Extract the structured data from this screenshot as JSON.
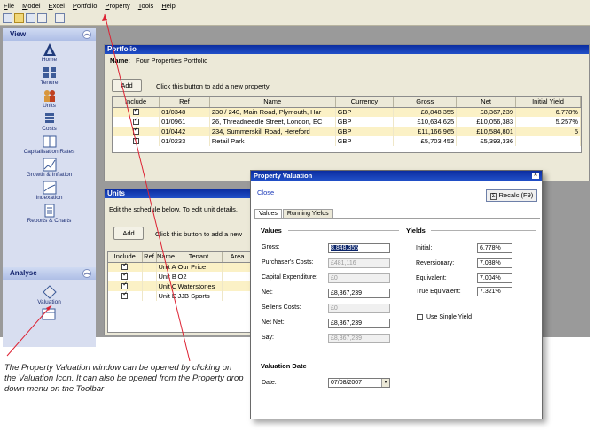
{
  "menu": [
    "File",
    "Model",
    "Excel",
    "Portfolio",
    "Property",
    "Tools",
    "Help"
  ],
  "view_panel": {
    "title": "View",
    "items": [
      "Home",
      "Tenure",
      "Units",
      "Costs",
      "Capitalisation Rates",
      "Growth & Inflation",
      "Indexation",
      "Reports & Charts"
    ]
  },
  "analyse_panel": {
    "title": "Analyse",
    "items": [
      "Valuation"
    ]
  },
  "portfolio": {
    "window_title": "Portfolio",
    "name_label": "Name:",
    "name_value": "Four Properties Portfolio",
    "add_label": "Add",
    "add_hint": "Click this button to add a new property",
    "columns": [
      "Include",
      "Ref",
      "Name",
      "Currency",
      "Gross",
      "Net",
      "Initial Yield"
    ],
    "rows": [
      {
        "ref": "01/0348",
        "name": "230 / 240, Main Road, Plymouth, Har",
        "currency": "GBP",
        "gross": "£8,848,355",
        "net": "£8,367,239",
        "yield": "6.778%"
      },
      {
        "ref": "01/0961",
        "name": "26, Threadneedle Street, London, EC",
        "currency": "GBP",
        "gross": "£10,634,625",
        "net": "£10,056,383",
        "yield": "5.257%"
      },
      {
        "ref": "01/0442",
        "name": "234, Summerskill Road, Hereford",
        "currency": "GBP",
        "gross": "£11,166,965",
        "net": "£10,584,801",
        "yield": "5"
      },
      {
        "ref": "01/0233",
        "name": "Retail Park",
        "currency": "GBP",
        "gross": "£5,703,453",
        "net": "£5,393,336",
        "yield": ""
      }
    ]
  },
  "units": {
    "window_title": "Units",
    "hint": "Edit the schedule below. To edit unit details,",
    "add_label": "Add",
    "add_hint": "Click this button to add a new",
    "columns": [
      "Include",
      "Ref",
      "Name",
      "Tenant",
      "Area"
    ],
    "rows": [
      {
        "name": "Unit A",
        "tenant": "Our Price"
      },
      {
        "name": "Unit B",
        "tenant": "O2"
      },
      {
        "name": "Unit C",
        "tenant": "Waterstones"
      },
      {
        "name": "Unit D",
        "tenant": "JJB Sports"
      }
    ]
  },
  "dialog": {
    "title": "Property Valuation",
    "close_link": "Close",
    "recalc_label": "Recalc (F9)",
    "tabs": [
      "Values",
      "Running Yields"
    ],
    "values_heading": "Values",
    "yields_heading": "Yields",
    "values": [
      {
        "label": "Gross:",
        "value": "8,848,355",
        "state": "selected"
      },
      {
        "label": "Purchaser's Costs:",
        "value": "£481,116",
        "state": "disabled"
      },
      {
        "label": "Capital Expenditure:",
        "value": "£0",
        "state": "disabled"
      },
      {
        "label": "Net:",
        "value": "£8,367,239",
        "state": "normal"
      },
      {
        "label": "Seller's Costs:",
        "value": "£0",
        "state": "disabled"
      },
      {
        "label": "Net Net:",
        "value": "£8,367,239",
        "state": "normal"
      },
      {
        "label": "Say:",
        "value": "£8,367,239",
        "state": "disabled"
      }
    ],
    "yields": [
      {
        "label": "Initial:",
        "value": "6.778%"
      },
      {
        "label": "Reversionary:",
        "value": "7.038%"
      },
      {
        "label": "Equivalent:",
        "value": "7.004%"
      },
      {
        "label": "True Equivalent:",
        "value": "7.321%"
      }
    ],
    "single_yield_label": "Use Single Yield",
    "valuation_date_heading": "Valuation Date",
    "date_label": "Date:",
    "date_value": "07/08/2007"
  },
  "caption": "The Property Valuation window can be opened by clicking on the Valuation Icon. It can also be opened from the Property drop down menu on the Toolbar",
  "colors": {
    "title_blue": "#0b2da0",
    "row_yellow": "#fbf1c6",
    "panel_blue": "#d8def0"
  }
}
